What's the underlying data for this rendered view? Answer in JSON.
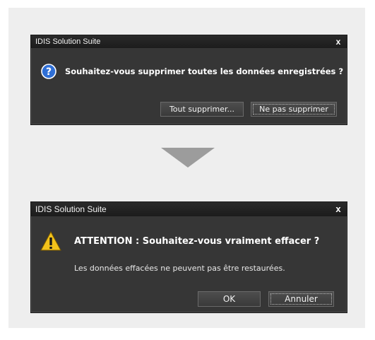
{
  "dialog1": {
    "title": "IDIS Solution Suite",
    "close": "x",
    "icon": "question-icon",
    "message": "Souhaitez-vous supprimer toutes les données enregistrées ?",
    "buttons": {
      "delete_all": "Tout supprimer...",
      "dont_delete": "Ne pas supprimer"
    }
  },
  "dialog2": {
    "title": "IDIS Solution Suite",
    "close": "x",
    "icon": "warning-icon",
    "message": "ATTENTION : Souhaitez-vous vraiment effacer ?",
    "submessage": "Les données effacées ne peuvent pas être restaurées.",
    "buttons": {
      "ok": "OK",
      "cancel": "Annuler"
    }
  },
  "colors": {
    "dialog_bg": "#363636",
    "titlebar_bg": "#1c1c1c",
    "panel_bg": "#eeeeee",
    "arrow": "#9c9c9c",
    "question_icon": "#2f6fd6",
    "warning_icon": "#f2c21b"
  }
}
